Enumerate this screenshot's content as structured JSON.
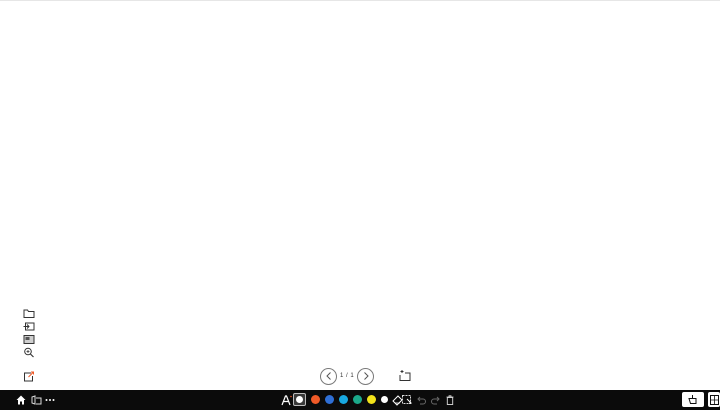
{
  "pager": {
    "indicator": "1 / 1",
    "prev_icon": "chevron-left-icon",
    "next_icon": "chevron-right-icon",
    "add_icon": "add-page-icon"
  },
  "left_tools": [
    {
      "name": "folder-icon"
    },
    {
      "name": "import-icon"
    },
    {
      "name": "background-icon"
    },
    {
      "name": "zoom-icon"
    },
    {
      "name": "export-icon"
    }
  ],
  "taskbar": {
    "home_icon": "home-icon",
    "apps_icon": "apps-icon",
    "more_icon": "more-icon",
    "text_icon": "text-tool-icon",
    "colors": [
      "#ffffff",
      "#f05a28",
      "#2f6fd6",
      "#18a8e0",
      "#1ba98a",
      "#f2e21a",
      "#ffffff"
    ],
    "selected_color_index": 0,
    "eraser_icon": "eraser-icon",
    "select_icon": "select-icon",
    "undo_icon": "undo-icon",
    "redo_icon": "redo-icon",
    "delete_icon": "trash-icon",
    "hand_icon": "hand-icon",
    "grid_icon": "grid-icon"
  },
  "accent_color": "#f05a28"
}
